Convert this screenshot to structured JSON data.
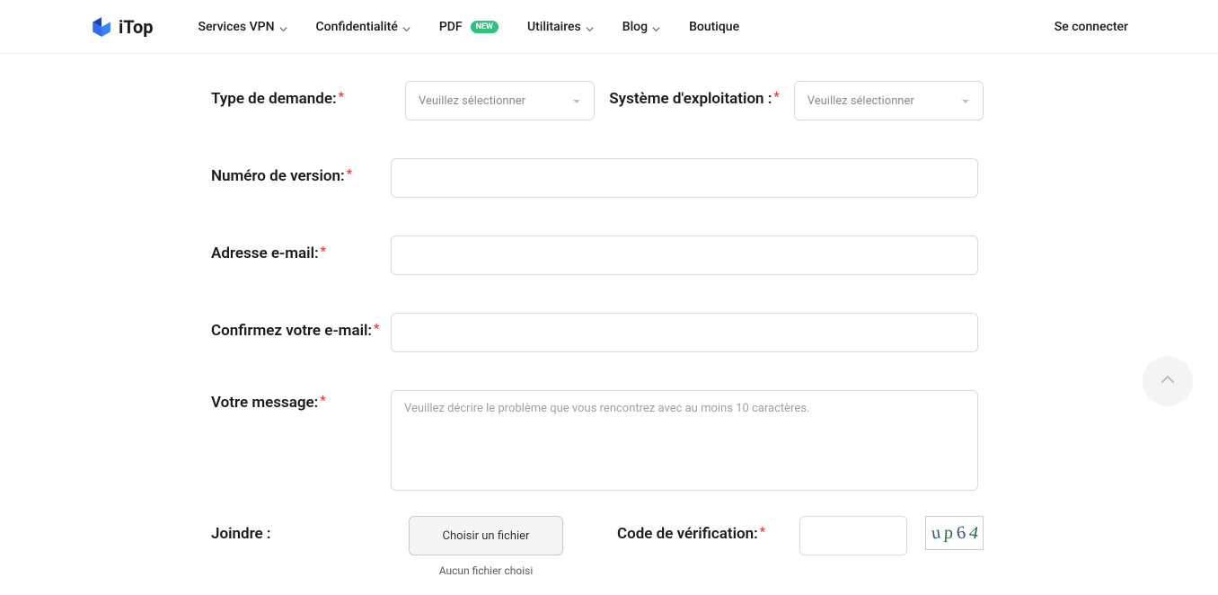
{
  "brand": {
    "name": "iTop"
  },
  "nav": {
    "items": [
      {
        "label": "Services VPN",
        "has_dropdown": true
      },
      {
        "label": "Confidentialité",
        "has_dropdown": true
      },
      {
        "label": "PDF",
        "badge": "NEW",
        "has_dropdown": false
      },
      {
        "label": "Utilitaires",
        "has_dropdown": true
      },
      {
        "label": "Blog",
        "has_dropdown": true
      },
      {
        "label": "Boutique",
        "has_dropdown": false
      }
    ],
    "login": "Se connecter"
  },
  "form": {
    "request_type": {
      "label": "Type de demande:",
      "placeholder": "Veuillez sélectionner"
    },
    "os": {
      "label": "Système d'exploitation :",
      "placeholder": "Veuillez sélectionner"
    },
    "version": {
      "label": "Numéro de version:"
    },
    "email": {
      "label": "Adresse e-mail:"
    },
    "confirm_email": {
      "label": "Confirmez votre e-mail:"
    },
    "message": {
      "label": "Votre message:",
      "placeholder": "Veuillez décrire le problème que vous rencontrez avec au moins 10 caractères."
    },
    "attach": {
      "label": "Joindre :",
      "button": "Choisir un fichier",
      "status": "Aucun fichier choisi"
    },
    "verify": {
      "label": "Code de vérification:"
    },
    "captcha": {
      "chars": [
        "u",
        "p",
        "6",
        "4"
      ]
    }
  }
}
